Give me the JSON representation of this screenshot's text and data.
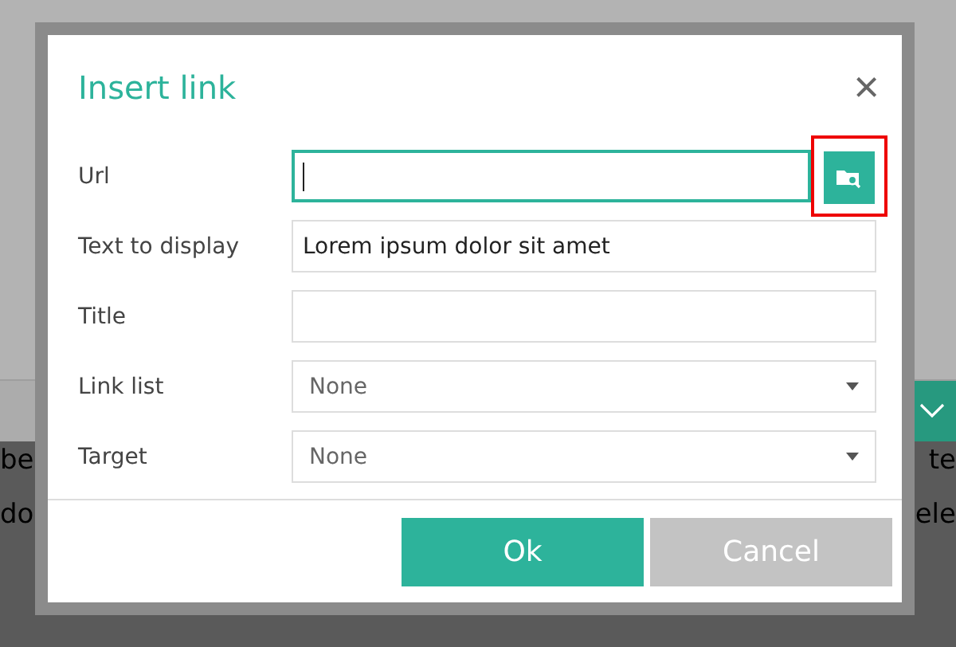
{
  "background": {
    "left_fragments": [
      "be",
      "do"
    ],
    "right_fragments": [
      "te",
      "ele"
    ]
  },
  "dialog": {
    "title": "Insert link",
    "close_label": "×",
    "fields": [
      {
        "label": "Url",
        "kind": "text",
        "focused": true,
        "browse_button": {
          "highlighted": true
        }
      },
      {
        "label": "Text to display",
        "kind": "text",
        "value": "Lorem ipsum dolor sit amet"
      },
      {
        "label": "Title",
        "kind": "text"
      },
      {
        "label": "Link list",
        "kind": "select",
        "value": "None"
      },
      {
        "label": "Target",
        "kind": "select",
        "value": "None"
      }
    ],
    "buttons": [
      {
        "label": "Ok",
        "kind": "primary"
      },
      {
        "label": "Cancel",
        "kind": "secondary"
      }
    ]
  }
}
